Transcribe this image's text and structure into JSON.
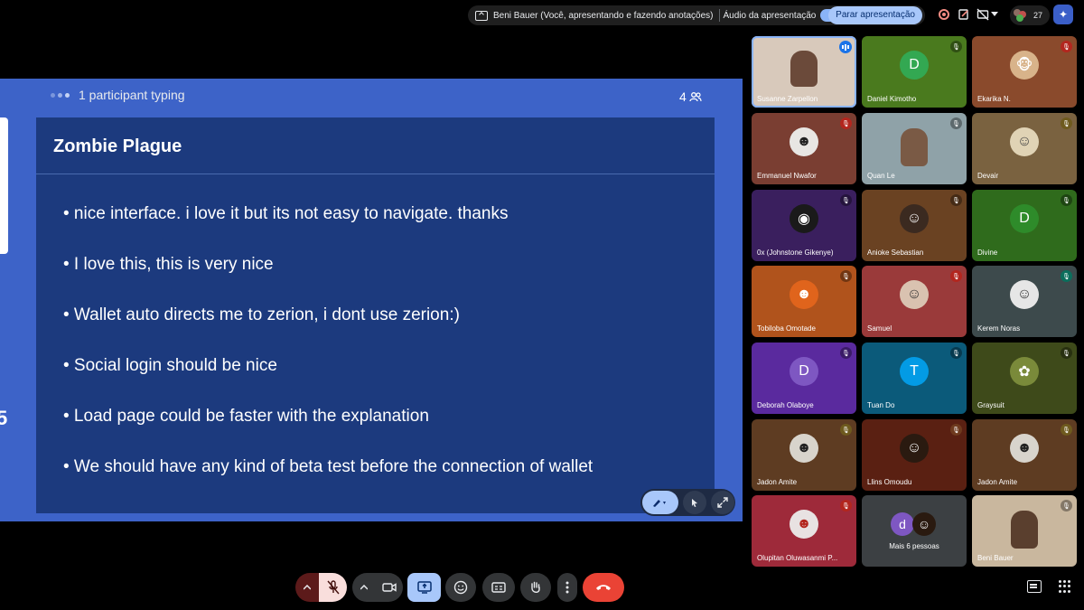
{
  "topbar": {
    "presenter_text": "Beni Bauer (Você, apresentando e fazendo anotações)",
    "audio_label": "Áudio da apresentação",
    "stop_label": "Parar apresentação",
    "participants_count": "27"
  },
  "presentation": {
    "typing_text": "1 participant typing",
    "viewer_count": "4",
    "side_number": "5",
    "slide": {
      "title": "Zombie Plague",
      "bullets": [
        "• nice interface. i love it but its not easy to navigate. thanks",
        "• I love this, this is very nice",
        "• Wallet auto directs me to zerion, i dont use zerion:)",
        "• Social login should be nice",
        "• Load page could be faster with the explanation",
        "• We should have any kind of beta test before the connection of wallet"
      ]
    }
  },
  "participants": [
    {
      "name": "Susanne Zarpellon"
    },
    {
      "name": "Daniel Kimotho",
      "initial": "D"
    },
    {
      "name": "Ekarika N."
    },
    {
      "name": "Emmanuel Nwafor"
    },
    {
      "name": "Quan Le"
    },
    {
      "name": "Devair"
    },
    {
      "name": "0x (Johnstone Gikenye)"
    },
    {
      "name": "Anioke Sebastian"
    },
    {
      "name": "Divine",
      "initial": "D"
    },
    {
      "name": "Tobiloba Omotade"
    },
    {
      "name": "Samuel"
    },
    {
      "name": "Kerem Noras"
    },
    {
      "name": "Deborah Olaboye",
      "initial": "D"
    },
    {
      "name": "Tuan Do",
      "initial": "T"
    },
    {
      "name": "Graysuit"
    },
    {
      "name": "Jadon Amite"
    },
    {
      "name": "Llins Omoudu"
    },
    {
      "name": "Jadon Amite"
    },
    {
      "name": "Olupitan Oluwasanmi P..."
    },
    {
      "name": "Mais 6 pessoas",
      "initial": "d"
    },
    {
      "name": "Beni Bauer"
    }
  ],
  "colors": {
    "slide_bg": "#3d63c8",
    "slide_card": "#1c3a7e",
    "end_call": "#ea4335",
    "accent": "#a8c7fa"
  }
}
